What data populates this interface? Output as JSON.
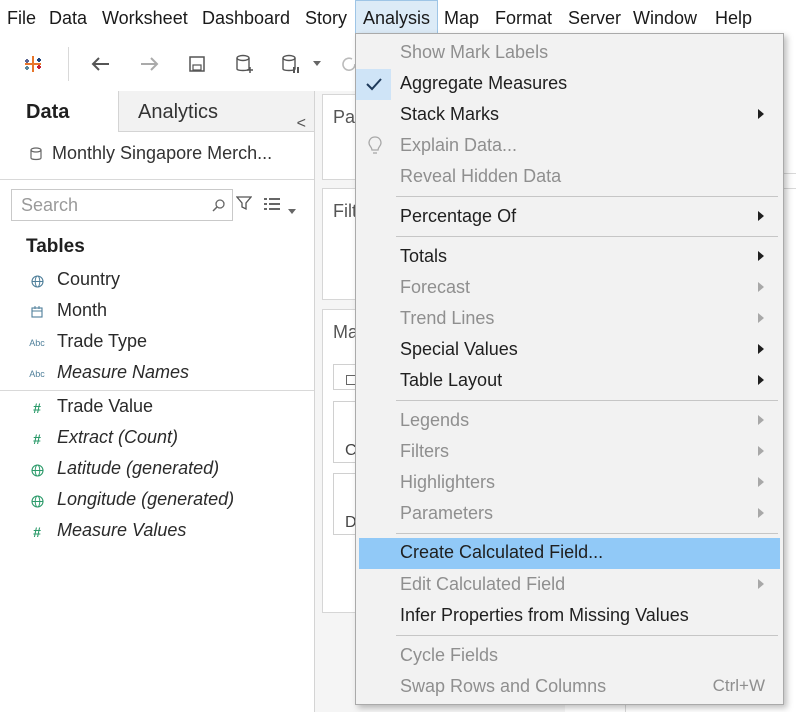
{
  "menubar": {
    "items": [
      "File",
      "Data",
      "Worksheet",
      "Dashboard",
      "Story",
      "Analysis",
      "Map",
      "Format",
      "Server",
      "Window",
      "Help"
    ],
    "active": "Analysis"
  },
  "toolbar": {
    "icons": [
      "tableau-logo-icon",
      "back-arrow-icon",
      "forward-arrow-icon",
      "save-icon",
      "new-data-source-icon",
      "pause-auto-updates-icon",
      "dropdown-caret-icon",
      "refresh-icon"
    ]
  },
  "left_pane": {
    "tab_data": "Data",
    "tab_analytics": "Analytics",
    "collapse_glyph": "<",
    "data_source": "Monthly Singapore Merch...",
    "search_placeholder": "Search",
    "tables_heading": "Tables",
    "dimensions": [
      {
        "name": "Country",
        "icon": "globe-icon",
        "italic": false
      },
      {
        "name": "Month",
        "icon": "calendar-icon",
        "italic": false
      },
      {
        "name": "Trade Type",
        "icon": "abc-icon",
        "italic": false
      },
      {
        "name": "Measure Names",
        "icon": "abc-icon",
        "italic": true
      }
    ],
    "measures": [
      {
        "name": "Trade Value",
        "icon": "hash-icon",
        "italic": false
      },
      {
        "name": "Extract (Count)",
        "icon": "hash-icon",
        "italic": true
      },
      {
        "name": "Latitude (generated)",
        "icon": "globe-icon",
        "italic": true
      },
      {
        "name": "Longitude (generated)",
        "icon": "globe-icon",
        "italic": true
      },
      {
        "name": "Measure Values",
        "icon": "hash-icon",
        "italic": true
      }
    ],
    "abc_text": "Abc"
  },
  "shelves": {
    "pages_label": "Pag",
    "filters_label": "Filt",
    "marks_label": "Ma",
    "mark_card_1": "C",
    "mark_card_2": "D"
  },
  "analysis_menu": {
    "items": [
      {
        "label": "Show Mark Labels",
        "enabled": false
      },
      {
        "label": "Aggregate Measures",
        "enabled": true,
        "checked": true
      },
      {
        "label": "Stack Marks",
        "enabled": true,
        "submenu": true
      },
      {
        "label": "Explain Data...",
        "enabled": false,
        "icon": "lightbulb-icon"
      },
      {
        "label": "Reveal Hidden Data",
        "enabled": false
      },
      {
        "label": "Percentage Of",
        "enabled": true,
        "submenu": true
      },
      {
        "label": "Totals",
        "enabled": true,
        "submenu": true
      },
      {
        "label": "Forecast",
        "enabled": false,
        "submenu": true
      },
      {
        "label": "Trend Lines",
        "enabled": false,
        "submenu": true
      },
      {
        "label": "Special Values",
        "enabled": true,
        "submenu": true
      },
      {
        "label": "Table Layout",
        "enabled": true,
        "submenu": true
      },
      {
        "label": "Legends",
        "enabled": false,
        "submenu": true
      },
      {
        "label": "Filters",
        "enabled": false,
        "submenu": true
      },
      {
        "label": "Highlighters",
        "enabled": false,
        "submenu": true
      },
      {
        "label": "Parameters",
        "enabled": false,
        "submenu": true
      },
      {
        "label": "Create Calculated Field...",
        "enabled": true,
        "highlighted": true
      },
      {
        "label": "Edit Calculated Field",
        "enabled": false,
        "submenu": true
      },
      {
        "label": "Infer Properties from Missing Values",
        "enabled": true
      },
      {
        "label": "Cycle Fields",
        "enabled": false
      },
      {
        "label": "Swap Rows and Columns",
        "enabled": false,
        "shortcut": "Ctrl+W"
      }
    ]
  },
  "colors": {
    "highlight": "#91c9f7",
    "check_bg": "#cfe4f7",
    "menu_bg": "#f2f2f2",
    "disabled_text": "#8f8f8f",
    "measure_icon": "#2d9b6b",
    "dimension_icon": "#4f7f9a"
  }
}
